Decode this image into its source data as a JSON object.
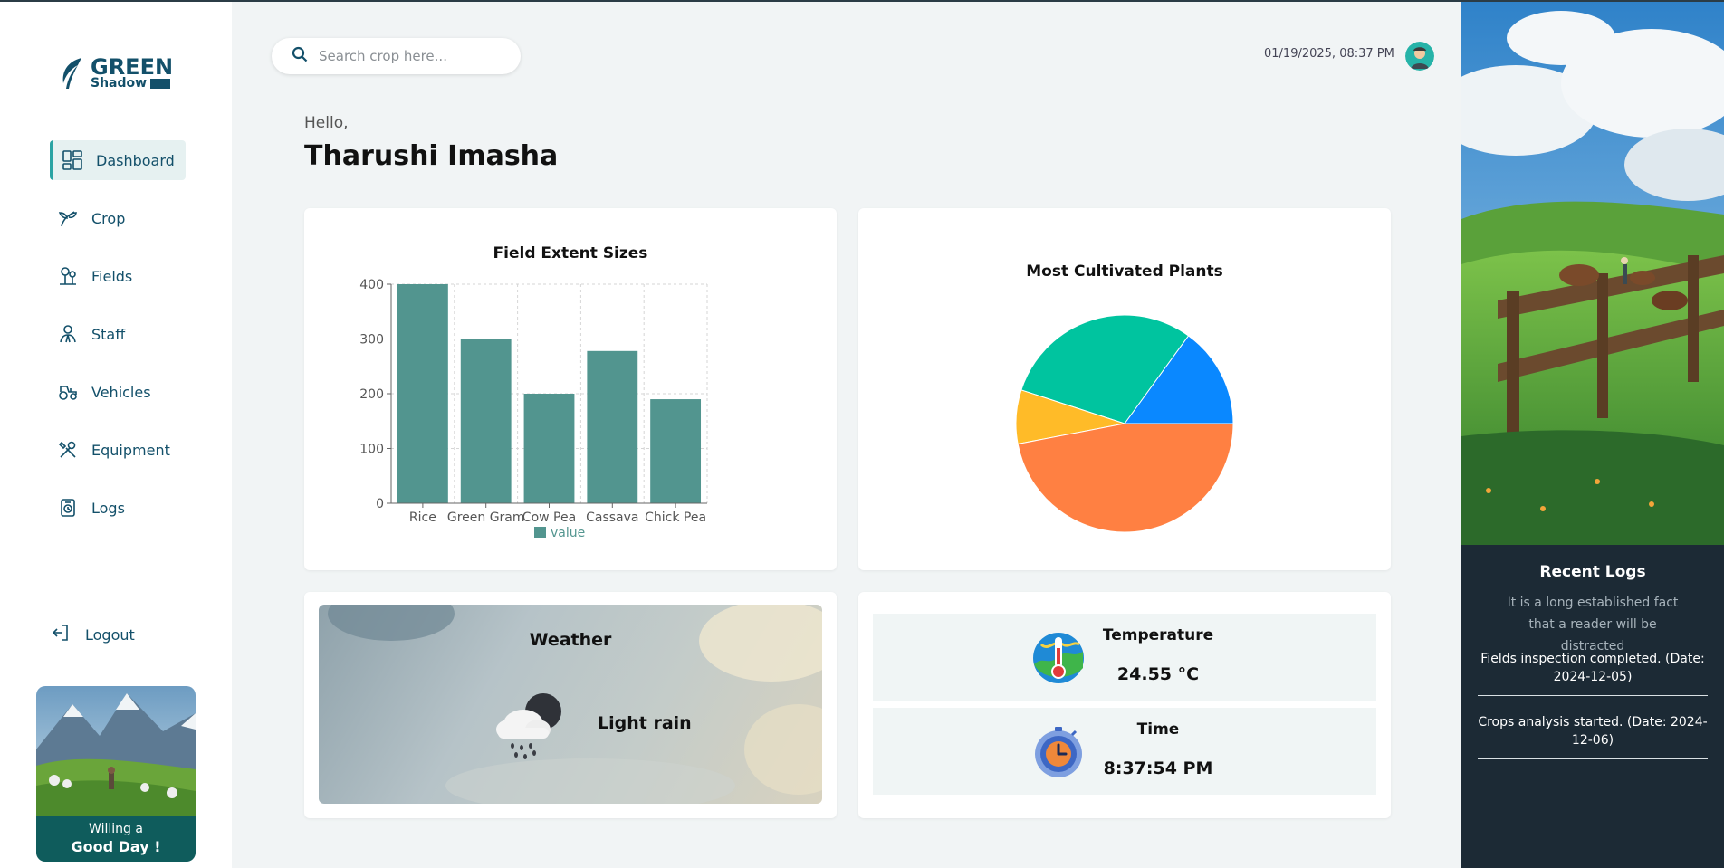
{
  "app": {
    "logo_top": "GREEN",
    "logo_bottom": "Shadow"
  },
  "sidebar": {
    "items": [
      {
        "label": "Dashboard",
        "icon": "dashboard-icon",
        "active": true
      },
      {
        "label": "Crop",
        "icon": "sprout-icon",
        "active": false
      },
      {
        "label": "Fields",
        "icon": "field-icon",
        "active": false
      },
      {
        "label": "Staff",
        "icon": "staff-icon",
        "active": false
      },
      {
        "label": "Vehicles",
        "icon": "tractor-icon",
        "active": false
      },
      {
        "label": "Equipment",
        "icon": "tools-icon",
        "active": false
      },
      {
        "label": "Logs",
        "icon": "logs-icon",
        "active": false
      }
    ],
    "logout": "Logout",
    "promo": {
      "line1": "Willing a",
      "line2": "Good Day !"
    }
  },
  "header": {
    "search_placeholder": "Search crop here...",
    "datetime": "01/19/2025, 08:37 PM"
  },
  "greeting": {
    "hello": "Hello,",
    "name": "Tharushi Imasha"
  },
  "chart_data": [
    {
      "type": "bar",
      "title": "Field Extent Sizes",
      "categories": [
        "Rice",
        "Green Gram",
        "Cow Pea",
        "Cassava",
        "Chick Pea"
      ],
      "values": [
        400,
        300,
        200,
        278,
        190
      ],
      "series": [
        {
          "name": "value",
          "values": [
            400,
            300,
            200,
            278,
            190
          ]
        }
      ],
      "ylim": [
        0,
        400
      ],
      "yticks": [
        0,
        100,
        200,
        300,
        400
      ],
      "grid": true,
      "legend": "bottom",
      "color": "#52958f"
    },
    {
      "type": "pie",
      "title": "Most Cultivated Plants",
      "values": [
        15,
        30,
        8,
        47
      ],
      "colors": [
        "#0a88ff",
        "#00c49f",
        "#ffbb28",
        "#ff8042"
      ]
    }
  ],
  "weather": {
    "title": "Weather",
    "description": "Light rain",
    "icon": "cloud-rain-icon"
  },
  "stats": {
    "temperature_label": "Temperature",
    "temperature_value": "24.55 °C",
    "time_label": "Time",
    "time_value": "8:37:54 PM"
  },
  "recent_logs": {
    "title": "Recent Logs",
    "description": "It is a long established fact that a reader will be distracted",
    "items": [
      "Fields inspection completed. (Date: 2024-12-05)",
      "Crops analysis started. (Date: 2024-12-06)"
    ]
  }
}
